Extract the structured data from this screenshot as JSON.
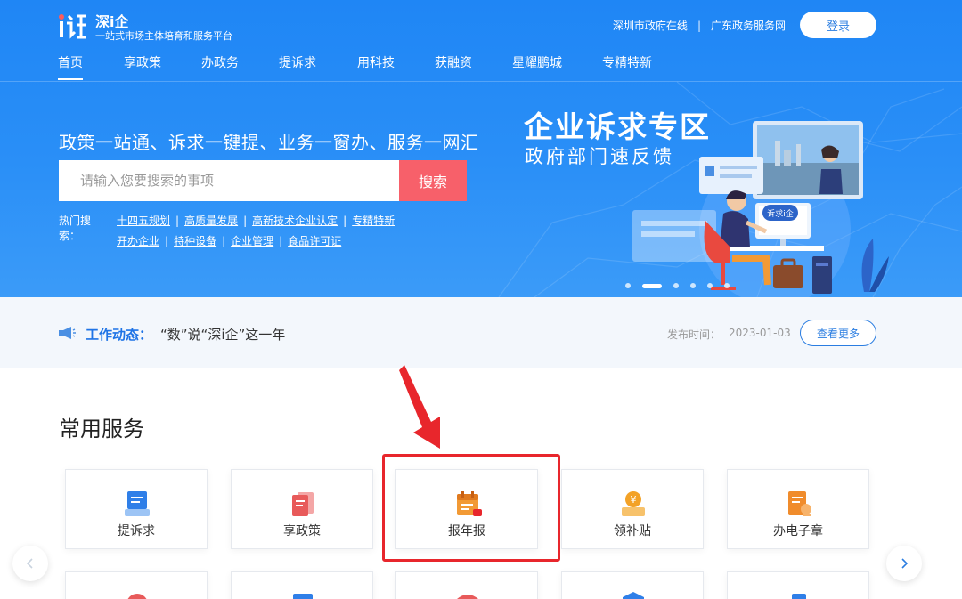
{
  "brand": {
    "name": "深i企",
    "subtitle": "一站式市场主体培育和服务平台"
  },
  "header": {
    "links": [
      "深圳市政府在线",
      "广东政务服务网"
    ],
    "separator": "|",
    "login_label": "登录"
  },
  "nav": {
    "items": [
      {
        "label": "首页",
        "active": true
      },
      {
        "label": "享政策"
      },
      {
        "label": "办政务"
      },
      {
        "label": "提诉求"
      },
      {
        "label": "用科技"
      },
      {
        "label": "获融资"
      },
      {
        "label": "星耀鹏城"
      },
      {
        "label": "专精特新"
      }
    ]
  },
  "hero": {
    "slogan": "政策一站通、诉求一键提、业务一窗办、服务一网汇",
    "search_placeholder": "请输入您要搜索的事项",
    "search_button": "搜索",
    "hot_label": "热门搜索：",
    "hot_tags_row1": [
      "十四五规划",
      "高质量发展",
      "高新技术企业认定",
      "专精特新"
    ],
    "hot_tags_row2": [
      "开办企业",
      "特种设备",
      "企业管理",
      "食品许可证"
    ],
    "banner_title": "企业诉求专区",
    "banner_subtitle": "政府部门速反馈",
    "banner_bubble": "诉求i企",
    "carousel": {
      "count": 6,
      "active_index": 1
    }
  },
  "news": {
    "label": "工作动态：",
    "headline": "“数”说“深i企”这一年",
    "publish_label": "发布时间：",
    "publish_date": "2023-01-03",
    "more_label": "查看更多"
  },
  "services": {
    "title": "常用服务",
    "row1": [
      {
        "label": "提诉求",
        "icon": "complaint-icon",
        "color": "#2f7fe8"
      },
      {
        "label": "享政策",
        "icon": "policy-icon",
        "color": "#e85a5a"
      },
      {
        "label": "报年报",
        "icon": "annual-report-icon",
        "color": "#f29a35",
        "highlighted": true
      },
      {
        "label": "领补贴",
        "icon": "subsidy-icon",
        "color": "#f3a227"
      },
      {
        "label": "办电子章",
        "icon": "e-seal-icon",
        "color": "#f08c2c"
      }
    ]
  },
  "colors": {
    "primary": "#1f86f5",
    "accent_red": "#f7606a",
    "highlight": "#e8262c",
    "link": "#2a7de1"
  }
}
